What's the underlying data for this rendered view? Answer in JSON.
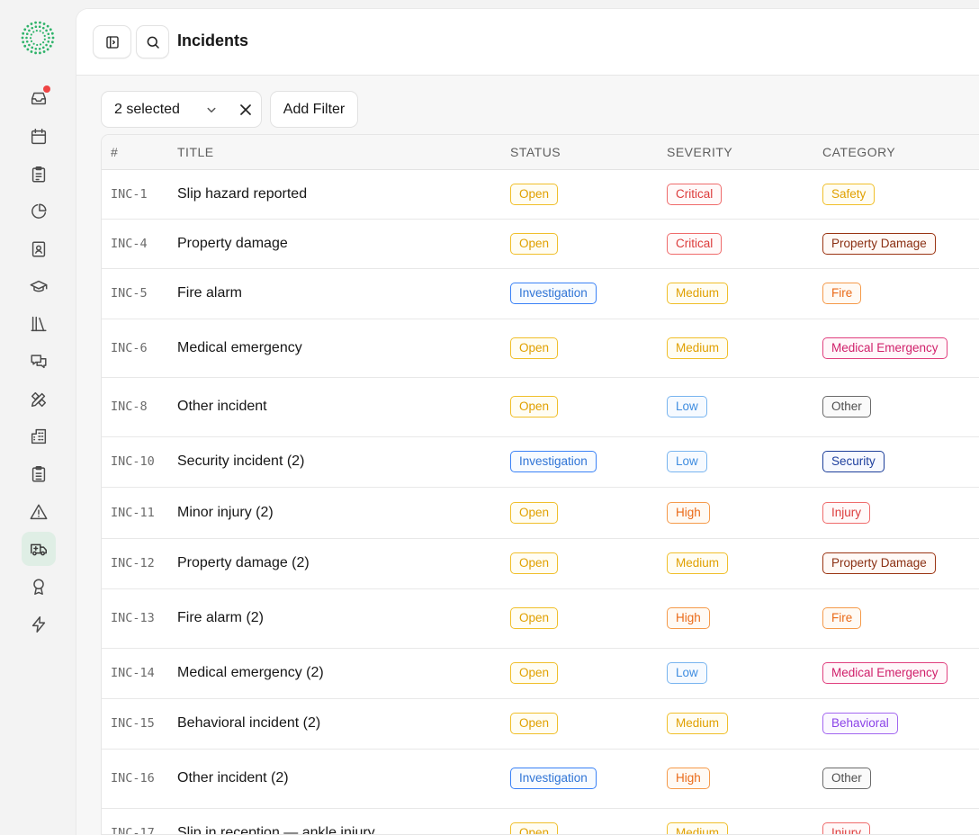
{
  "header": {
    "title": "Incidents"
  },
  "filters": {
    "selected_label": "2 selected",
    "add_filter_label": "Add Filter"
  },
  "table": {
    "columns": [
      "#",
      "TITLE",
      "STATUS",
      "SEVERITY",
      "CATEGORY"
    ],
    "rows": [
      {
        "id": "INC-1",
        "title": "Slip hazard reported",
        "status": "Open",
        "severity": "Critical",
        "category": "Safety"
      },
      {
        "id": "INC-4",
        "title": "Property damage",
        "status": "Open",
        "severity": "Critical",
        "category": "Property Damage"
      },
      {
        "id": "INC-5",
        "title": "Fire alarm",
        "status": "Investigation",
        "severity": "Medium",
        "category": "Fire"
      },
      {
        "id": "INC-6",
        "title": "Medical emergency",
        "status": "Open",
        "severity": "Medium",
        "category": "Medical Emergency"
      },
      {
        "id": "INC-8",
        "title": "Other incident",
        "status": "Open",
        "severity": "Low",
        "category": "Other"
      },
      {
        "id": "INC-10",
        "title": "Security incident (2)",
        "status": "Investigation",
        "severity": "Low",
        "category": "Security"
      },
      {
        "id": "INC-11",
        "title": "Minor injury (2)",
        "status": "Open",
        "severity": "High",
        "category": "Injury"
      },
      {
        "id": "INC-12",
        "title": "Property damage (2)",
        "status": "Open",
        "severity": "Medium",
        "category": "Property Damage"
      },
      {
        "id": "INC-13",
        "title": "Fire alarm (2)",
        "status": "Open",
        "severity": "High",
        "category": "Fire"
      },
      {
        "id": "INC-14",
        "title": "Medical emergency (2)",
        "status": "Open",
        "severity": "Low",
        "category": "Medical Emergency"
      },
      {
        "id": "INC-15",
        "title": "Behavioral incident (2)",
        "status": "Open",
        "severity": "Medium",
        "category": "Behavioral"
      },
      {
        "id": "INC-16",
        "title": "Other incident (2)",
        "status": "Investigation",
        "severity": "High",
        "category": "Other"
      },
      {
        "id": "INC-17",
        "title": "Slip in reception — ankle injury",
        "status": "Open",
        "severity": "Medium",
        "category": "Injury"
      }
    ]
  },
  "sidebar": {
    "items": [
      {
        "icon": "inbox-icon",
        "has_notification": true
      },
      {
        "icon": "calendar-icon"
      },
      {
        "icon": "clipboard-icon"
      },
      {
        "icon": "pie-chart-icon"
      },
      {
        "icon": "contact-card-icon"
      },
      {
        "icon": "graduation-cap-icon"
      },
      {
        "icon": "library-icon"
      },
      {
        "icon": "chat-icon"
      },
      {
        "icon": "pencil-ruler-icon"
      },
      {
        "icon": "building-icon"
      },
      {
        "icon": "clipboard-list-icon"
      },
      {
        "icon": "warning-icon"
      },
      {
        "icon": "ambulance-icon",
        "active": true
      },
      {
        "icon": "award-icon"
      },
      {
        "icon": "lightning-icon"
      }
    ]
  },
  "badge_colors": {
    "Open": "#e0a000",
    "Investigation": "#2f74d6",
    "Critical": "#dc3c3c",
    "High": "#ea6a18",
    "Medium": "#e0a000",
    "Low": "#3f8de0",
    "Safety": "#e0a000",
    "Property Damage": "#8a2f12",
    "Fire": "#ea6a18",
    "Medical Emergency": "#d01f6a",
    "Other": "#4f4f4f",
    "Security": "#1e3f9e",
    "Injury": "#dc3c3c",
    "Behavioral": "#8b43e8"
  }
}
